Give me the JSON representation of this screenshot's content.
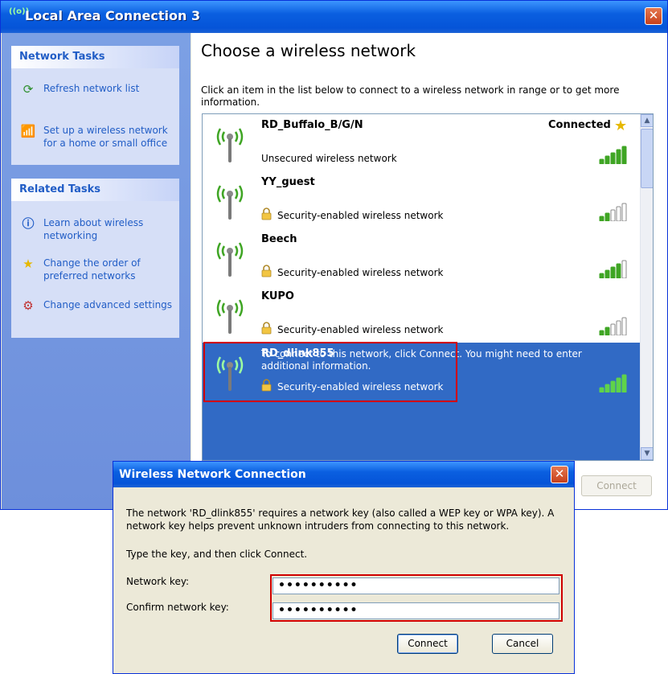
{
  "window": {
    "title": "Local Area Connection 3",
    "title_icon": "((o))"
  },
  "sidebar": {
    "network_tasks": {
      "header": "Network Tasks",
      "items": [
        {
          "label": "Refresh network list",
          "icon": "refresh-icon"
        },
        {
          "label": "Set up a wireless network for a home or small office",
          "icon": "wireless-setup-icon"
        }
      ]
    },
    "related_tasks": {
      "header": "Related Tasks",
      "items": [
        {
          "label": "Learn about wireless networking",
          "icon": "info-icon"
        },
        {
          "label": "Change the order of preferred networks",
          "icon": "star-icon"
        },
        {
          "label": "Change advanced settings",
          "icon": "settings-icon"
        }
      ]
    }
  },
  "main": {
    "heading": "Choose a wireless network",
    "intro": "Click an item in the list below to connect to a wireless network in range or to get more information.",
    "networks": [
      {
        "ssid": "RD_Buffalo_B/G/N",
        "security": "Unsecured wireless network",
        "status": "Connected",
        "signal": 5,
        "secured": false,
        "selected": false
      },
      {
        "ssid": "YY_guest",
        "security": "Security-enabled wireless network",
        "status": "",
        "signal": 2,
        "secured": true,
        "selected": false
      },
      {
        "ssid": "Beech",
        "security": "Security-enabled wireless network",
        "status": "",
        "signal": 4,
        "secured": true,
        "selected": false
      },
      {
        "ssid": "KUPO",
        "security": "Security-enabled wireless network",
        "status": "",
        "signal": 2,
        "secured": true,
        "selected": false
      },
      {
        "ssid": "RD_dlink855",
        "security": "Security-enabled wireless network",
        "status": "",
        "signal": 5,
        "secured": true,
        "selected": true
      }
    ],
    "selected_hint": "To connect to this network, click Connect. You might need to enter additional information.",
    "connect_button": "Connect"
  },
  "dialog": {
    "title": "Wireless Network Connection",
    "message": "The network 'RD_dlink855' requires a network key (also called a WEP key or WPA key). A network key helps prevent unknown intruders from connecting to this network.",
    "prompt": "Type the key, and then click Connect.",
    "network_key_label": "Network key:",
    "network_key_value": "••••••••••",
    "confirm_key_label": "Confirm network key:",
    "confirm_key_value": "••••••••••",
    "connect_button": "Connect",
    "cancel_button": "Cancel"
  },
  "colors": {
    "title_bar": "#0a5fe0",
    "selection": "#316ac5",
    "highlight_box": "#d00000",
    "signal_green": "#3fa524"
  }
}
